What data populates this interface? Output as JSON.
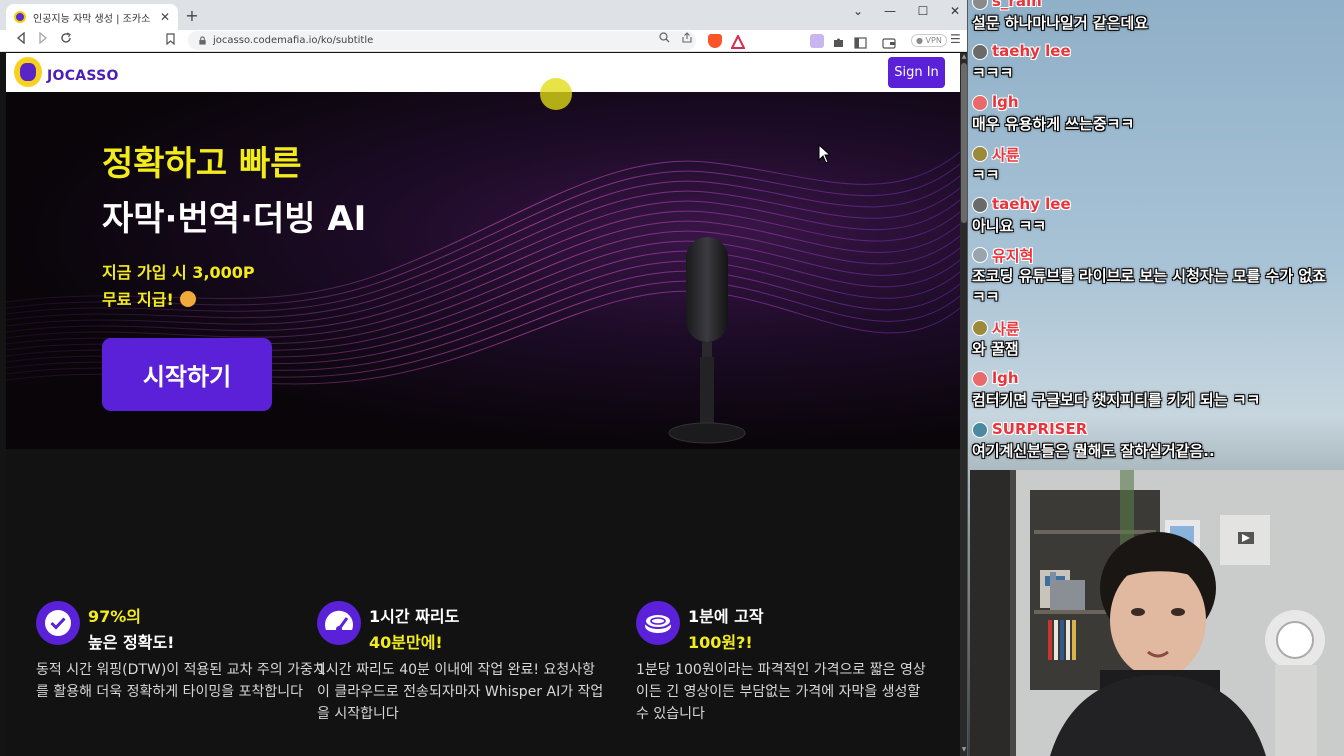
{
  "browser": {
    "tab_title": "인공지능 자막 생성 | 조카소",
    "new_tab_symbol": "+",
    "tab_close_symbol": "✕",
    "window_controls": [
      "⌄",
      "—",
      "☐",
      "✕"
    ],
    "url": "jocasso.codemafia.io/ko/subtitle",
    "vpn_label": "● VPN",
    "nav_icons": [
      "back-icon",
      "forward-icon",
      "reload-icon"
    ]
  },
  "site": {
    "logo_text": "JOCASSO",
    "sign_in_label": "Sign In",
    "brand_color": "#5b21d9",
    "accent_color": "#f3ec1c"
  },
  "hero": {
    "headline_1": "정확하고 빠른",
    "headline_2": "자막·번역·더빙 AI",
    "promo_1": "지금 가입 시 3,000P",
    "promo_2": "무료 지급!",
    "cta_label": "시작하기"
  },
  "features": [
    {
      "icon": "check-circle-icon",
      "title_1": "97%의",
      "title_2": "높은 정확도!",
      "description": "동적 시간 워핑(DTW)이 적용된 교차 주의 가중치를 활용해 더욱 정확하게 타이밍을 포착합니다"
    },
    {
      "icon": "speedometer-icon",
      "title_1": "1시간 짜리도",
      "title_2": "40분만에!",
      "description": "1시간 짜리도 40분 이내에 작업 완료! 요청사항이 클라우드로 전송되자마자 Whisper AI가 작업을 시작합니다"
    },
    {
      "icon": "coin-icon",
      "title_1": "1분에 고작",
      "title_2": "100원?!",
      "description": "1분당 100원이라는 파격적인 가격으로 짧은 영상이든 긴 영상이든 부담없는 가격에 자막을 생성할 수 있습니다"
    }
  ],
  "chat": [
    {
      "user": "s_rain",
      "message": "설문 하나마나일거 같은데요"
    },
    {
      "user": "taehy lee",
      "message": "ㅋㅋㅋ"
    },
    {
      "user": "lgh",
      "message": "매우 유용하게 쓰는중ㅋㅋ"
    },
    {
      "user": "사륜",
      "message": "ㅋㅋ"
    },
    {
      "user": "taehy lee",
      "message": "아니요 ㅋㅋ"
    },
    {
      "user": "유지혁",
      "message": "조코딩 유튜브를 라이브로 보는 시청자는 모를 수가 없죠 ㅋㅋ"
    },
    {
      "user": "사륜",
      "message": "와 꿀잼"
    },
    {
      "user": "lgh",
      "message": "컴터키면 구글보다 챗지피티를 키게 되는 ㅋㅋ"
    },
    {
      "user": "SURPRISER",
      "message": "여기계신분들은 뭘해도 잘하실거같음.."
    }
  ]
}
